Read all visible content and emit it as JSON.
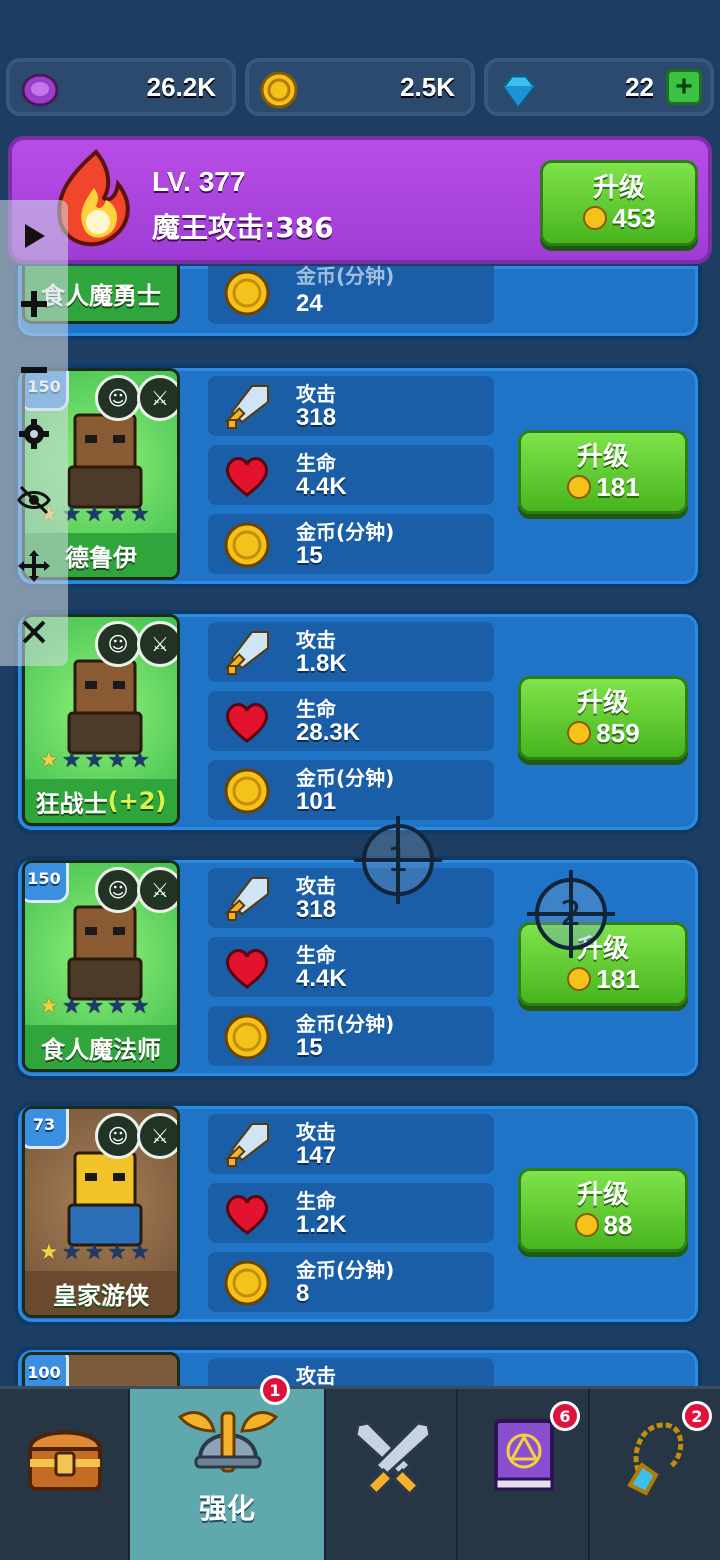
{
  "currencies": [
    {
      "icon": "purple-coin-icon",
      "value": "26.2K"
    },
    {
      "icon": "gold-coin-icon",
      "value": "2.5K"
    },
    {
      "icon": "gem-icon",
      "value": "22"
    }
  ],
  "add_gem_symbol": "+",
  "banner": {
    "level": "LV. 377",
    "attack": "魔王攻击:386",
    "upgrade_label": "升级",
    "upgrade_cost": "453"
  },
  "partial_hero": {
    "name": "食人魔勇士",
    "coin_label": "金币(分钟)",
    "coin_value": "24"
  },
  "heroes": [
    {
      "name": "德鲁伊",
      "name_bonus": "",
      "level": "150",
      "stars_on": 1,
      "attack_label": "攻击",
      "attack": "318",
      "hp_label": "生命",
      "hp": "4.4K",
      "coin_label": "金币(分钟)",
      "coin": "15",
      "upgrade_label": "升级",
      "upgrade_cost": "181",
      "card_color": "green"
    },
    {
      "name": "狂战士",
      "name_bonus": "(+2)",
      "level": "",
      "stars_on": 1,
      "attack_label": "攻击",
      "attack": "1.8K",
      "hp_label": "生命",
      "hp": "28.3K",
      "coin_label": "金币(分钟)",
      "coin": "101",
      "upgrade_label": "升级",
      "upgrade_cost": "859",
      "card_color": "green"
    },
    {
      "name": "食人魔法师",
      "name_bonus": "",
      "level": "150",
      "stars_on": 1,
      "attack_label": "攻击",
      "attack": "318",
      "hp_label": "生命",
      "hp": "4.4K",
      "coin_label": "金币(分钟)",
      "coin": "15",
      "upgrade_label": "升级",
      "upgrade_cost": "181",
      "card_color": "green"
    },
    {
      "name": "皇家游侠",
      "name_bonus": "",
      "level": "73",
      "stars_on": 1,
      "attack_label": "攻击",
      "attack": "147",
      "hp_label": "生命",
      "hp": "1.2K",
      "coin_label": "金币(分钟)",
      "coin": "8",
      "upgrade_label": "升级",
      "upgrade_cost": "88",
      "card_color": "brown"
    }
  ],
  "next_hero": {
    "level": "100",
    "attack_label": "攻击"
  },
  "crosshairs": [
    "1",
    "2"
  ],
  "nav": {
    "tabs": [
      {
        "icon": "treasure-chest-icon",
        "label": ""
      },
      {
        "icon": "winged-helmet-icon",
        "label": "强化",
        "badge": "1"
      },
      {
        "icon": "crossed-swords-icon",
        "label": ""
      },
      {
        "icon": "spellbook-icon",
        "label": "",
        "badge": "6"
      },
      {
        "icon": "amulet-icon",
        "label": "",
        "badge": "2"
      }
    ]
  },
  "colors": {
    "background": "#1d3d63",
    "panel": "#1f74c7",
    "banner": "#b84de6",
    "button": "#5ccb2c",
    "active_tab": "#5fa8ae",
    "badge": "#e0123c"
  }
}
